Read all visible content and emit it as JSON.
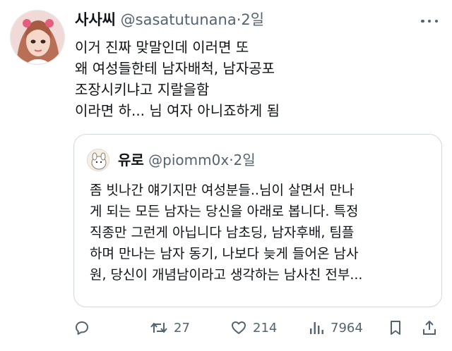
{
  "author": {
    "display_name": "사사씨",
    "handle": "@sasatutunana",
    "separator": "·",
    "time": "2일"
  },
  "body_lines": [
    "이거 진짜 맞말인데 이러면 또",
    "왜 여성들한테 남자배척, 남자공포",
    "조장시키냐고 지랄을함",
    "이라면 하... 님 여자 아니죠하게 됨"
  ],
  "quote": {
    "display_name": "유로",
    "handle": "@piomm0x",
    "separator": "·",
    "time": "2일",
    "lines": [
      "좀 빗나간 얘기지만 여성분들..님이 살면서 만나",
      "게 되는 모든 남자는 당신을 아래로 봅니다. 특정",
      "직종만 그런게 아닙니다 남초딩, 남자후배, 팀플",
      "하며 만나는 남자 동기, 나보다 늦게 들어온 남사",
      "원, 당신이 개념남이라고 생각하는 남사친 전부..."
    ]
  },
  "actions": {
    "reply_icon": "reply-icon",
    "retweet_icon": "retweet-icon",
    "retweet_count": "27",
    "like_icon": "heart-icon",
    "like_count": "214",
    "views_icon": "views-icon",
    "view_count": "7964",
    "bookmark_icon": "bookmark-icon",
    "share_icon": "share-icon"
  },
  "colors": {
    "text": "#0f1419",
    "secondary": "#536471",
    "border": "#cfd9de",
    "background": "#ffffff"
  }
}
